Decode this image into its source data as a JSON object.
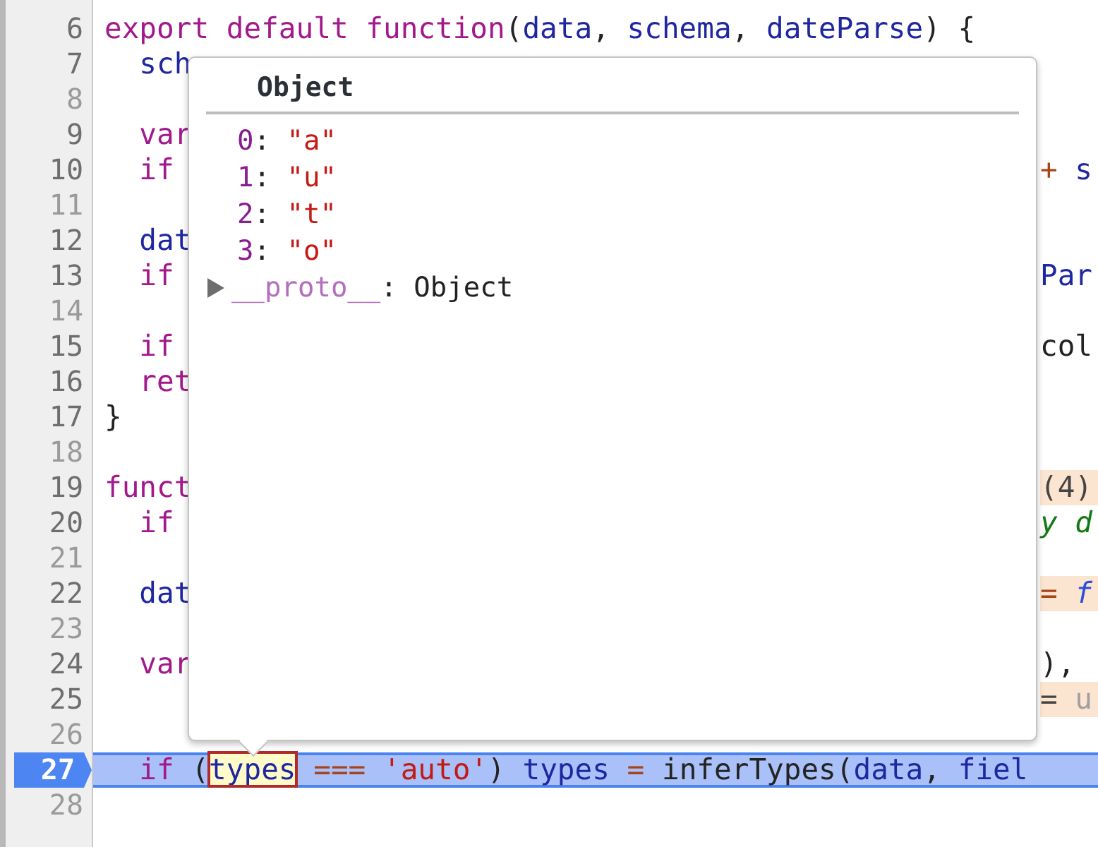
{
  "editor": {
    "lines": [
      {
        "number": "6",
        "blank": false,
        "current": false,
        "left": [
          {
            "text": "export default function",
            "kind": "keyword"
          },
          {
            "text": "(",
            "kind": "plain"
          },
          {
            "text": "data",
            "kind": "variable"
          },
          {
            "text": ", ",
            "kind": "plain"
          },
          {
            "text": "schema",
            "kind": "variable"
          },
          {
            "text": ", ",
            "kind": "plain"
          },
          {
            "text": "dateParse",
            "kind": "variable"
          },
          {
            "text": ") {",
            "kind": "plain"
          }
        ],
        "children": [
          {
            "number": "7",
            "blank": false,
            "current": false,
            "left": [
              {
                "text": "sch",
                "kind": "variable"
              }
            ]
          },
          {
            "number": "8",
            "blank": true,
            "current": false
          },
          {
            "number": "9",
            "blank": false,
            "current": false,
            "left": [
              {
                "text": "var",
                "kind": "keyword"
              }
            ]
          },
          {
            "number": "10",
            "blank": false,
            "current": false,
            "left": [
              {
                "text": "if",
                "kind": "keyword"
              }
            ],
            "right": [
              {
                "text": "+",
                "kind": "operator"
              },
              {
                "text": " s",
                "kind": "variable"
              }
            ],
            "right_highlighted": false
          },
          {
            "number": "11",
            "blank": true,
            "current": false
          },
          {
            "number": "12",
            "blank": false,
            "current": false,
            "left": [
              {
                "text": "dat",
                "kind": "variable"
              }
            ]
          },
          {
            "number": "13",
            "blank": false,
            "current": false,
            "left": [
              {
                "text": "if",
                "kind": "keyword"
              }
            ],
            "right": [
              {
                "text": "Par",
                "kind": "variable"
              }
            ],
            "right_highlighted": false
          },
          {
            "number": "14",
            "blank": true,
            "current": false
          },
          {
            "number": "15",
            "blank": false,
            "current": false,
            "left": [
              {
                "text": "if",
                "kind": "keyword"
              }
            ],
            "right": [
              {
                "text": "col",
                "kind": "plain"
              }
            ],
            "right_highlighted": false
          },
          {
            "number": "16",
            "blank": false,
            "current": false,
            "left": [
              {
                "text": "ret",
                "kind": "keyword"
              }
            ]
          }
        ]
      },
      {
        "number": "17",
        "blank": false,
        "current": false,
        "left": [
          {
            "text": "}",
            "kind": "plain"
          }
        ]
      },
      {
        "number": "18",
        "blank": true,
        "current": false
      },
      {
        "number": "19",
        "blank": false,
        "current": false,
        "left": [
          {
            "text": "funct",
            "kind": "keyword"
          }
        ],
        "right": [
          {
            "text": "(4)",
            "kind": "muted"
          }
        ],
        "right_highlighted": true,
        "children": [
          {
            "number": "20",
            "blank": false,
            "current": false,
            "left": [
              {
                "text": "if",
                "kind": "keyword"
              }
            ],
            "right": [
              {
                "text": "y d",
                "kind": "comment"
              }
            ],
            "right_highlighted": false
          },
          {
            "number": "21",
            "blank": true,
            "current": false
          },
          {
            "number": "22",
            "blank": false,
            "current": false,
            "left": [
              {
                "text": "dat",
                "kind": "variable"
              }
            ],
            "right": [
              {
                "text": "=",
                "kind": "operator"
              },
              {
                "text": " f",
                "kind": "function"
              }
            ],
            "right_highlighted": true
          },
          {
            "number": "23",
            "blank": true,
            "current": false
          },
          {
            "number": "24",
            "blank": false,
            "current": false,
            "left": [
              {
                "text": "var",
                "kind": "keyword"
              }
            ],
            "right": [
              {
                "text": "),",
                "kind": "plain"
              }
            ],
            "right_highlighted": false
          },
          {
            "number": "25",
            "blank": false,
            "current": false,
            "right": [
              {
                "text": "=",
                "kind": "muted"
              },
              {
                "text": " u",
                "kind": "faded"
              }
            ],
            "right_highlighted": true
          },
          {
            "number": "26",
            "blank": true,
            "current": false
          },
          {
            "number": "27",
            "blank": false,
            "current": true,
            "left": [
              {
                "text": "if",
                "kind": "keyword",
                "hovered": false
              },
              {
                "text": " (",
                "kind": "plain",
                "hovered": false
              },
              {
                "text": "types",
                "kind": "variable",
                "hovered": true
              },
              {
                "text": " ===",
                "kind": "operator",
                "hovered": false
              },
              {
                "text": " 'auto'",
                "kind": "string",
                "hovered": false
              },
              {
                "text": ") ",
                "kind": "plain",
                "hovered": false
              },
              {
                "text": "types",
                "kind": "variable",
                "hovered": false
              },
              {
                "text": " =",
                "kind": "operator",
                "hovered": false
              },
              {
                "text": " inferTypes(",
                "kind": "plain",
                "hovered": false
              },
              {
                "text": "data",
                "kind": "variable",
                "hovered": false
              },
              {
                "text": ", ",
                "kind": "plain",
                "hovered": false
              },
              {
                "text": "fiel",
                "kind": "variable",
                "hovered": false
              }
            ]
          },
          {
            "number": "28",
            "blank": true,
            "current": false
          }
        ]
      }
    ]
  },
  "popover": {
    "title": "Object",
    "entries": [
      {
        "key": "0",
        "separator": ":",
        "value": "\"a\""
      },
      {
        "key": "1",
        "separator": ":",
        "value": "\"u\""
      },
      {
        "key": "2",
        "separator": ":",
        "value": "\"t\""
      },
      {
        "key": "3",
        "separator": ":",
        "value": "\"o\""
      }
    ],
    "proto": {
      "key": "__proto__",
      "separator": ":",
      "value": "Object",
      "expanded": false
    }
  }
}
